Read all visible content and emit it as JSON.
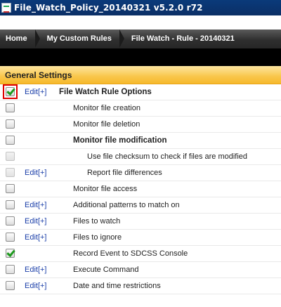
{
  "window": {
    "title": "File_Watch_Policy_20140321 v5.2.0 r72",
    "icon": "app-icon"
  },
  "breadcrumb": [
    {
      "label": "Home"
    },
    {
      "label": "My Custom Rules"
    },
    {
      "label": "File Watch - Rule - 20140321"
    }
  ],
  "section": {
    "title": "General Settings"
  },
  "rows": [
    {
      "checked": true,
      "disabled": false,
      "highlighted": true,
      "edit": "Edit[+]",
      "label": "File Watch Rule Options",
      "style": "head"
    },
    {
      "checked": false,
      "disabled": false,
      "highlighted": false,
      "edit": "",
      "label": "Monitor file creation",
      "style": "l1"
    },
    {
      "checked": false,
      "disabled": false,
      "highlighted": false,
      "edit": "",
      "label": "Monitor file deletion",
      "style": "l1"
    },
    {
      "checked": false,
      "disabled": false,
      "highlighted": false,
      "edit": "",
      "label": "Monitor file modification",
      "style": "l1 bold"
    },
    {
      "checked": false,
      "disabled": true,
      "highlighted": false,
      "edit": "",
      "label": "Use file checksum to check if files are modified",
      "style": "l2"
    },
    {
      "checked": false,
      "disabled": true,
      "highlighted": false,
      "edit": "Edit[+]",
      "label": "Report file differences",
      "style": "l2"
    },
    {
      "checked": false,
      "disabled": false,
      "highlighted": false,
      "edit": "",
      "label": "Monitor file access",
      "style": "l1"
    },
    {
      "checked": false,
      "disabled": false,
      "highlighted": false,
      "edit": "Edit[+]",
      "label": "Additional patterns to match on",
      "style": "l1"
    },
    {
      "checked": false,
      "disabled": false,
      "highlighted": false,
      "edit": "Edit[+]",
      "label": "Files to watch",
      "style": "l1"
    },
    {
      "checked": false,
      "disabled": false,
      "highlighted": false,
      "edit": "Edit[+]",
      "label": "Files to ignore",
      "style": "l1"
    },
    {
      "checked": true,
      "disabled": false,
      "highlighted": false,
      "edit": "",
      "label": "Record Event to SDCSS Console",
      "style": "l1"
    },
    {
      "checked": false,
      "disabled": false,
      "highlighted": false,
      "edit": "Edit[+]",
      "label": "Execute Command",
      "style": "l1"
    },
    {
      "checked": false,
      "disabled": false,
      "highlighted": false,
      "edit": "Edit[+]",
      "label": "Date and time restrictions",
      "style": "l1"
    }
  ],
  "colors": {
    "link": "#1a3ea8",
    "check": "#1d9a1d",
    "highlight": "#e00000",
    "section_bg": "#f9c64a",
    "titlebar_bg": "#0b2f66"
  }
}
